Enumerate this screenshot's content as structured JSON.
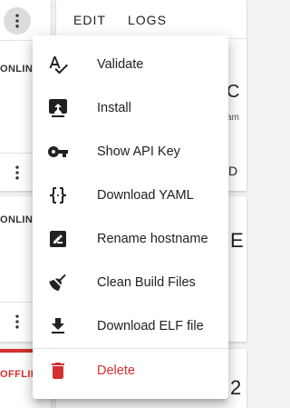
{
  "cards": {
    "left_1_status": "ONLINE",
    "left_2_status": "ONLINE",
    "left_3_status": "OFFLINE",
    "right_1_peek_title": "C",
    "right_1_peek_sub": "am",
    "right_1_peek_action": "D",
    "right_2_peek_title": "E",
    "right_3_peek_title": "2"
  },
  "toolbar": {
    "edit_label": "EDIT",
    "logs_label": "LOGS"
  },
  "menu": {
    "items": [
      {
        "label": "Validate",
        "icon": "spellcheck-icon"
      },
      {
        "label": "Install",
        "icon": "upload-icon"
      },
      {
        "label": "Show API Key",
        "icon": "key-icon"
      },
      {
        "label": "Download YAML",
        "icon": "code-braces-icon"
      },
      {
        "label": "Rename hostname",
        "icon": "rename-icon"
      },
      {
        "label": "Clean Build Files",
        "icon": "broom-icon"
      },
      {
        "label": "Download ELF file",
        "icon": "download-icon"
      }
    ],
    "delete": {
      "label": "Delete",
      "icon": "delete-icon"
    }
  },
  "colors": {
    "danger": "#d32f2f",
    "text": "#212121"
  }
}
